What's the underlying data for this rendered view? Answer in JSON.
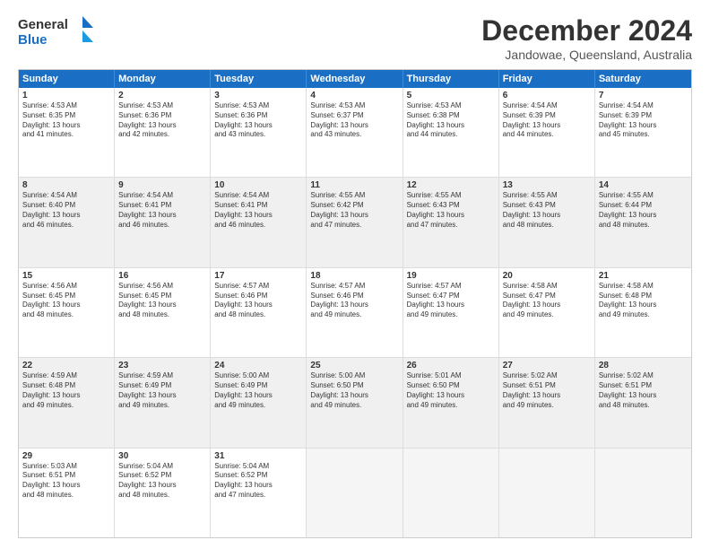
{
  "header": {
    "logo_line1": "General",
    "logo_line2": "Blue",
    "title": "December 2024",
    "subtitle": "Jandowae, Queensland, Australia"
  },
  "days": [
    "Sunday",
    "Monday",
    "Tuesday",
    "Wednesday",
    "Thursday",
    "Friday",
    "Saturday"
  ],
  "weeks": [
    [
      {
        "day": "1",
        "rise": "4:53 AM",
        "set": "6:35 PM",
        "light": "13 hours and 41 minutes."
      },
      {
        "day": "2",
        "rise": "4:53 AM",
        "set": "6:36 PM",
        "light": "13 hours and 42 minutes."
      },
      {
        "day": "3",
        "rise": "4:53 AM",
        "set": "6:36 PM",
        "light": "13 hours and 43 minutes."
      },
      {
        "day": "4",
        "rise": "4:53 AM",
        "set": "6:37 PM",
        "light": "13 hours and 43 minutes."
      },
      {
        "day": "5",
        "rise": "4:53 AM",
        "set": "6:38 PM",
        "light": "13 hours and 44 minutes."
      },
      {
        "day": "6",
        "rise": "4:54 AM",
        "set": "6:39 PM",
        "light": "13 hours and 44 minutes."
      },
      {
        "day": "7",
        "rise": "4:54 AM",
        "set": "6:39 PM",
        "light": "13 hours and 45 minutes."
      }
    ],
    [
      {
        "day": "8",
        "rise": "4:54 AM",
        "set": "6:40 PM",
        "light": "13 hours and 46 minutes."
      },
      {
        "day": "9",
        "rise": "4:54 AM",
        "set": "6:41 PM",
        "light": "13 hours and 46 minutes."
      },
      {
        "day": "10",
        "rise": "4:54 AM",
        "set": "6:41 PM",
        "light": "13 hours and 46 minutes."
      },
      {
        "day": "11",
        "rise": "4:55 AM",
        "set": "6:42 PM",
        "light": "13 hours and 47 minutes."
      },
      {
        "day": "12",
        "rise": "4:55 AM",
        "set": "6:43 PM",
        "light": "13 hours and 47 minutes."
      },
      {
        "day": "13",
        "rise": "4:55 AM",
        "set": "6:43 PM",
        "light": "13 hours and 48 minutes."
      },
      {
        "day": "14",
        "rise": "4:55 AM",
        "set": "6:44 PM",
        "light": "13 hours and 48 minutes."
      }
    ],
    [
      {
        "day": "15",
        "rise": "4:56 AM",
        "set": "6:45 PM",
        "light": "13 hours and 48 minutes."
      },
      {
        "day": "16",
        "rise": "4:56 AM",
        "set": "6:45 PM",
        "light": "13 hours and 48 minutes."
      },
      {
        "day": "17",
        "rise": "4:57 AM",
        "set": "6:46 PM",
        "light": "13 hours and 48 minutes."
      },
      {
        "day": "18",
        "rise": "4:57 AM",
        "set": "6:46 PM",
        "light": "13 hours and 49 minutes."
      },
      {
        "day": "19",
        "rise": "4:57 AM",
        "set": "6:47 PM",
        "light": "13 hours and 49 minutes."
      },
      {
        "day": "20",
        "rise": "4:58 AM",
        "set": "6:47 PM",
        "light": "13 hours and 49 minutes."
      },
      {
        "day": "21",
        "rise": "4:58 AM",
        "set": "6:48 PM",
        "light": "13 hours and 49 minutes."
      }
    ],
    [
      {
        "day": "22",
        "rise": "4:59 AM",
        "set": "6:48 PM",
        "light": "13 hours and 49 minutes."
      },
      {
        "day": "23",
        "rise": "4:59 AM",
        "set": "6:49 PM",
        "light": "13 hours and 49 minutes."
      },
      {
        "day": "24",
        "rise": "5:00 AM",
        "set": "6:49 PM",
        "light": "13 hours and 49 minutes."
      },
      {
        "day": "25",
        "rise": "5:00 AM",
        "set": "6:50 PM",
        "light": "13 hours and 49 minutes."
      },
      {
        "day": "26",
        "rise": "5:01 AM",
        "set": "6:50 PM",
        "light": "13 hours and 49 minutes."
      },
      {
        "day": "27",
        "rise": "5:02 AM",
        "set": "6:51 PM",
        "light": "13 hours and 49 minutes."
      },
      {
        "day": "28",
        "rise": "5:02 AM",
        "set": "6:51 PM",
        "light": "13 hours and 48 minutes."
      }
    ],
    [
      {
        "day": "29",
        "rise": "5:03 AM",
        "set": "6:51 PM",
        "light": "13 hours and 48 minutes."
      },
      {
        "day": "30",
        "rise": "5:04 AM",
        "set": "6:52 PM",
        "light": "13 hours and 48 minutes."
      },
      {
        "day": "31",
        "rise": "5:04 AM",
        "set": "6:52 PM",
        "light": "13 hours and 47 minutes."
      },
      null,
      null,
      null,
      null
    ]
  ],
  "labels": {
    "sunrise": "Sunrise:",
    "sunset": "Sunset:",
    "daylight": "Daylight:"
  }
}
